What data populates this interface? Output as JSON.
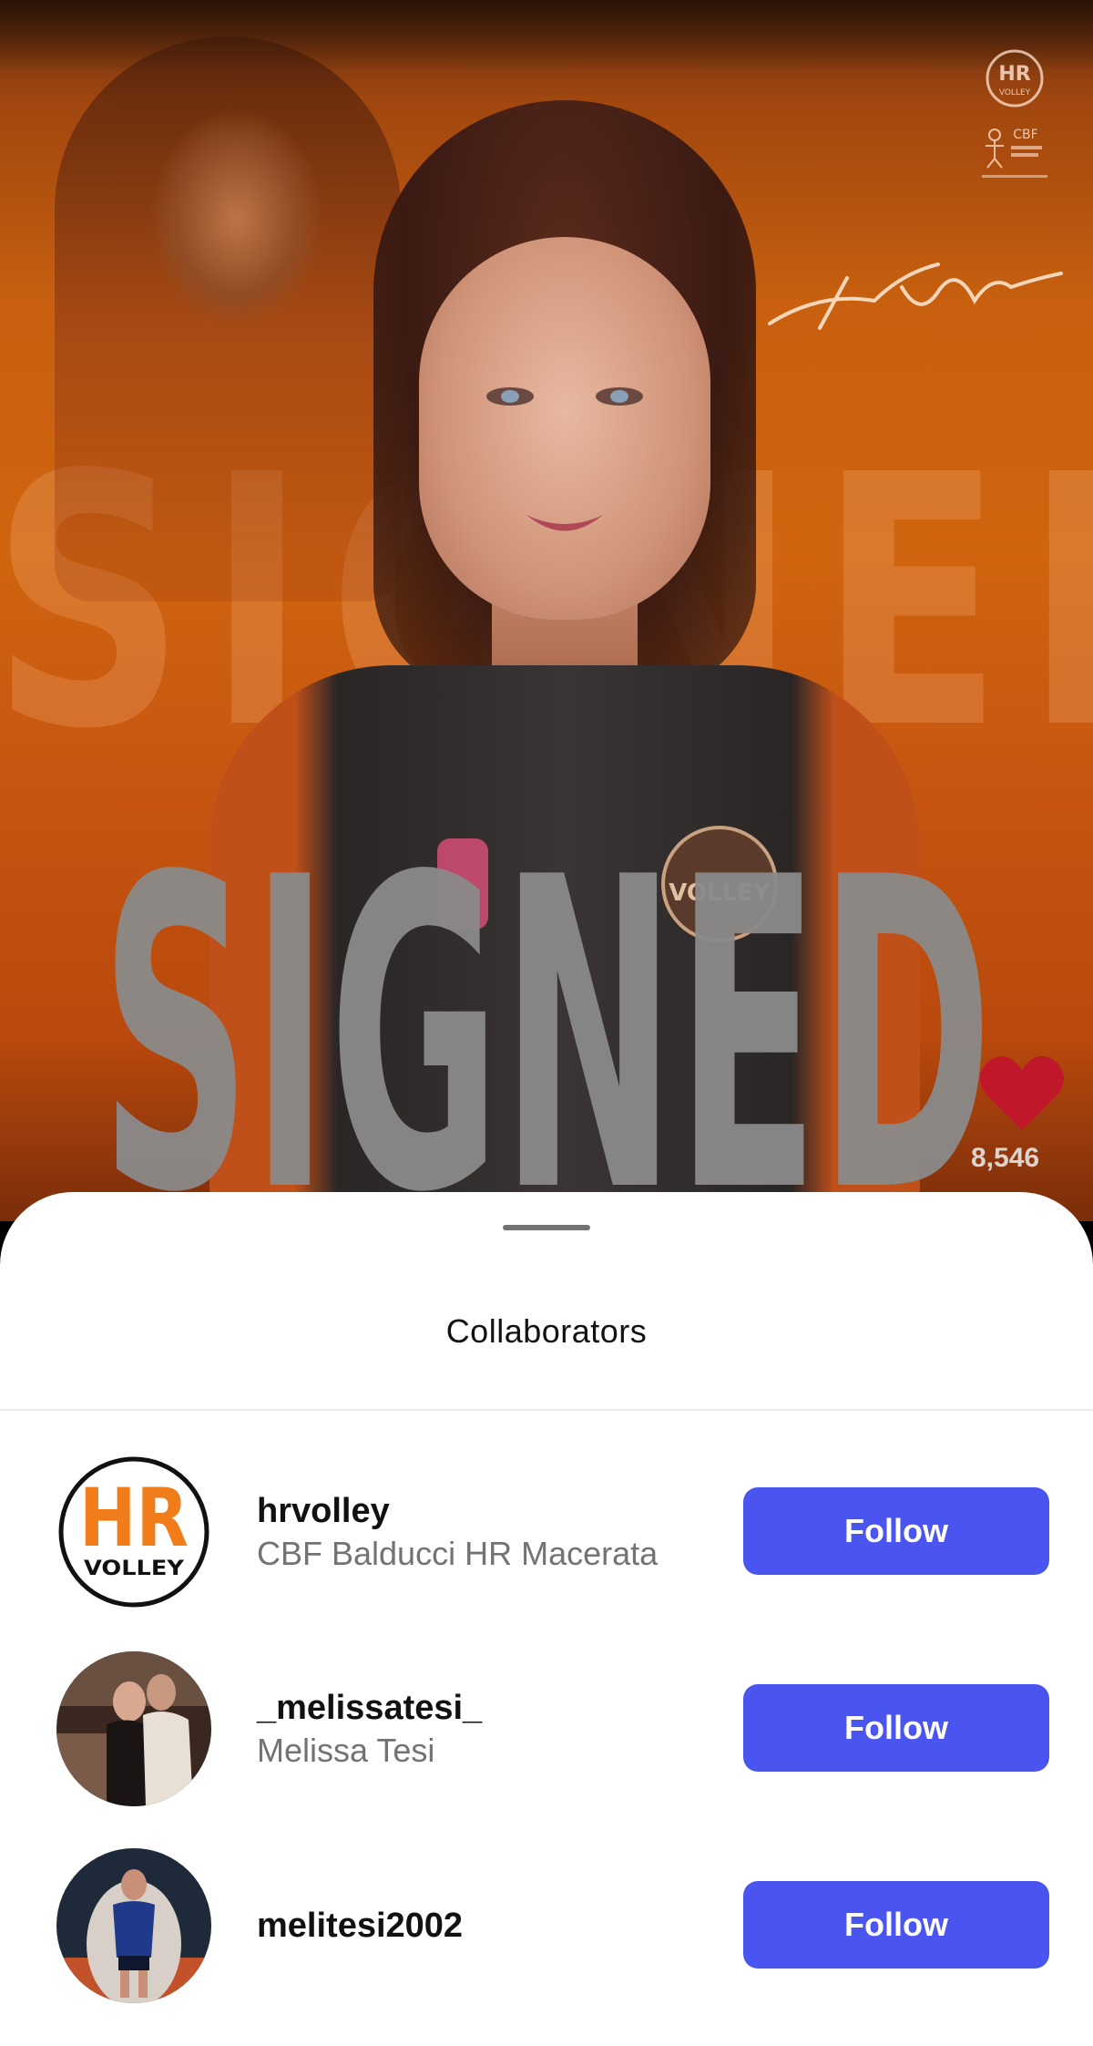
{
  "post": {
    "background_word": "SIGNED",
    "overlay_word": "SIGNED",
    "like_count": "8,546",
    "heart_color": "#c0182a"
  },
  "sheet": {
    "title": "Collaborators",
    "collaborators": [
      {
        "username": "hrvolley",
        "full_name": "CBF Balducci HR Macerata",
        "button_label": "Follow"
      },
      {
        "username": "_melissatesi_",
        "full_name": "Melissa Tesi",
        "button_label": "Follow"
      },
      {
        "username": "melitesi2002",
        "full_name": "",
        "button_label": "Follow"
      }
    ]
  },
  "colors": {
    "follow_button": "#4a55f0",
    "hr_logo_orange": "#f07d1a"
  },
  "icons": [
    "hr-volley-logo-icon",
    "cbf-balducci-logo-icon",
    "heart-icon",
    "signature-graphic"
  ]
}
